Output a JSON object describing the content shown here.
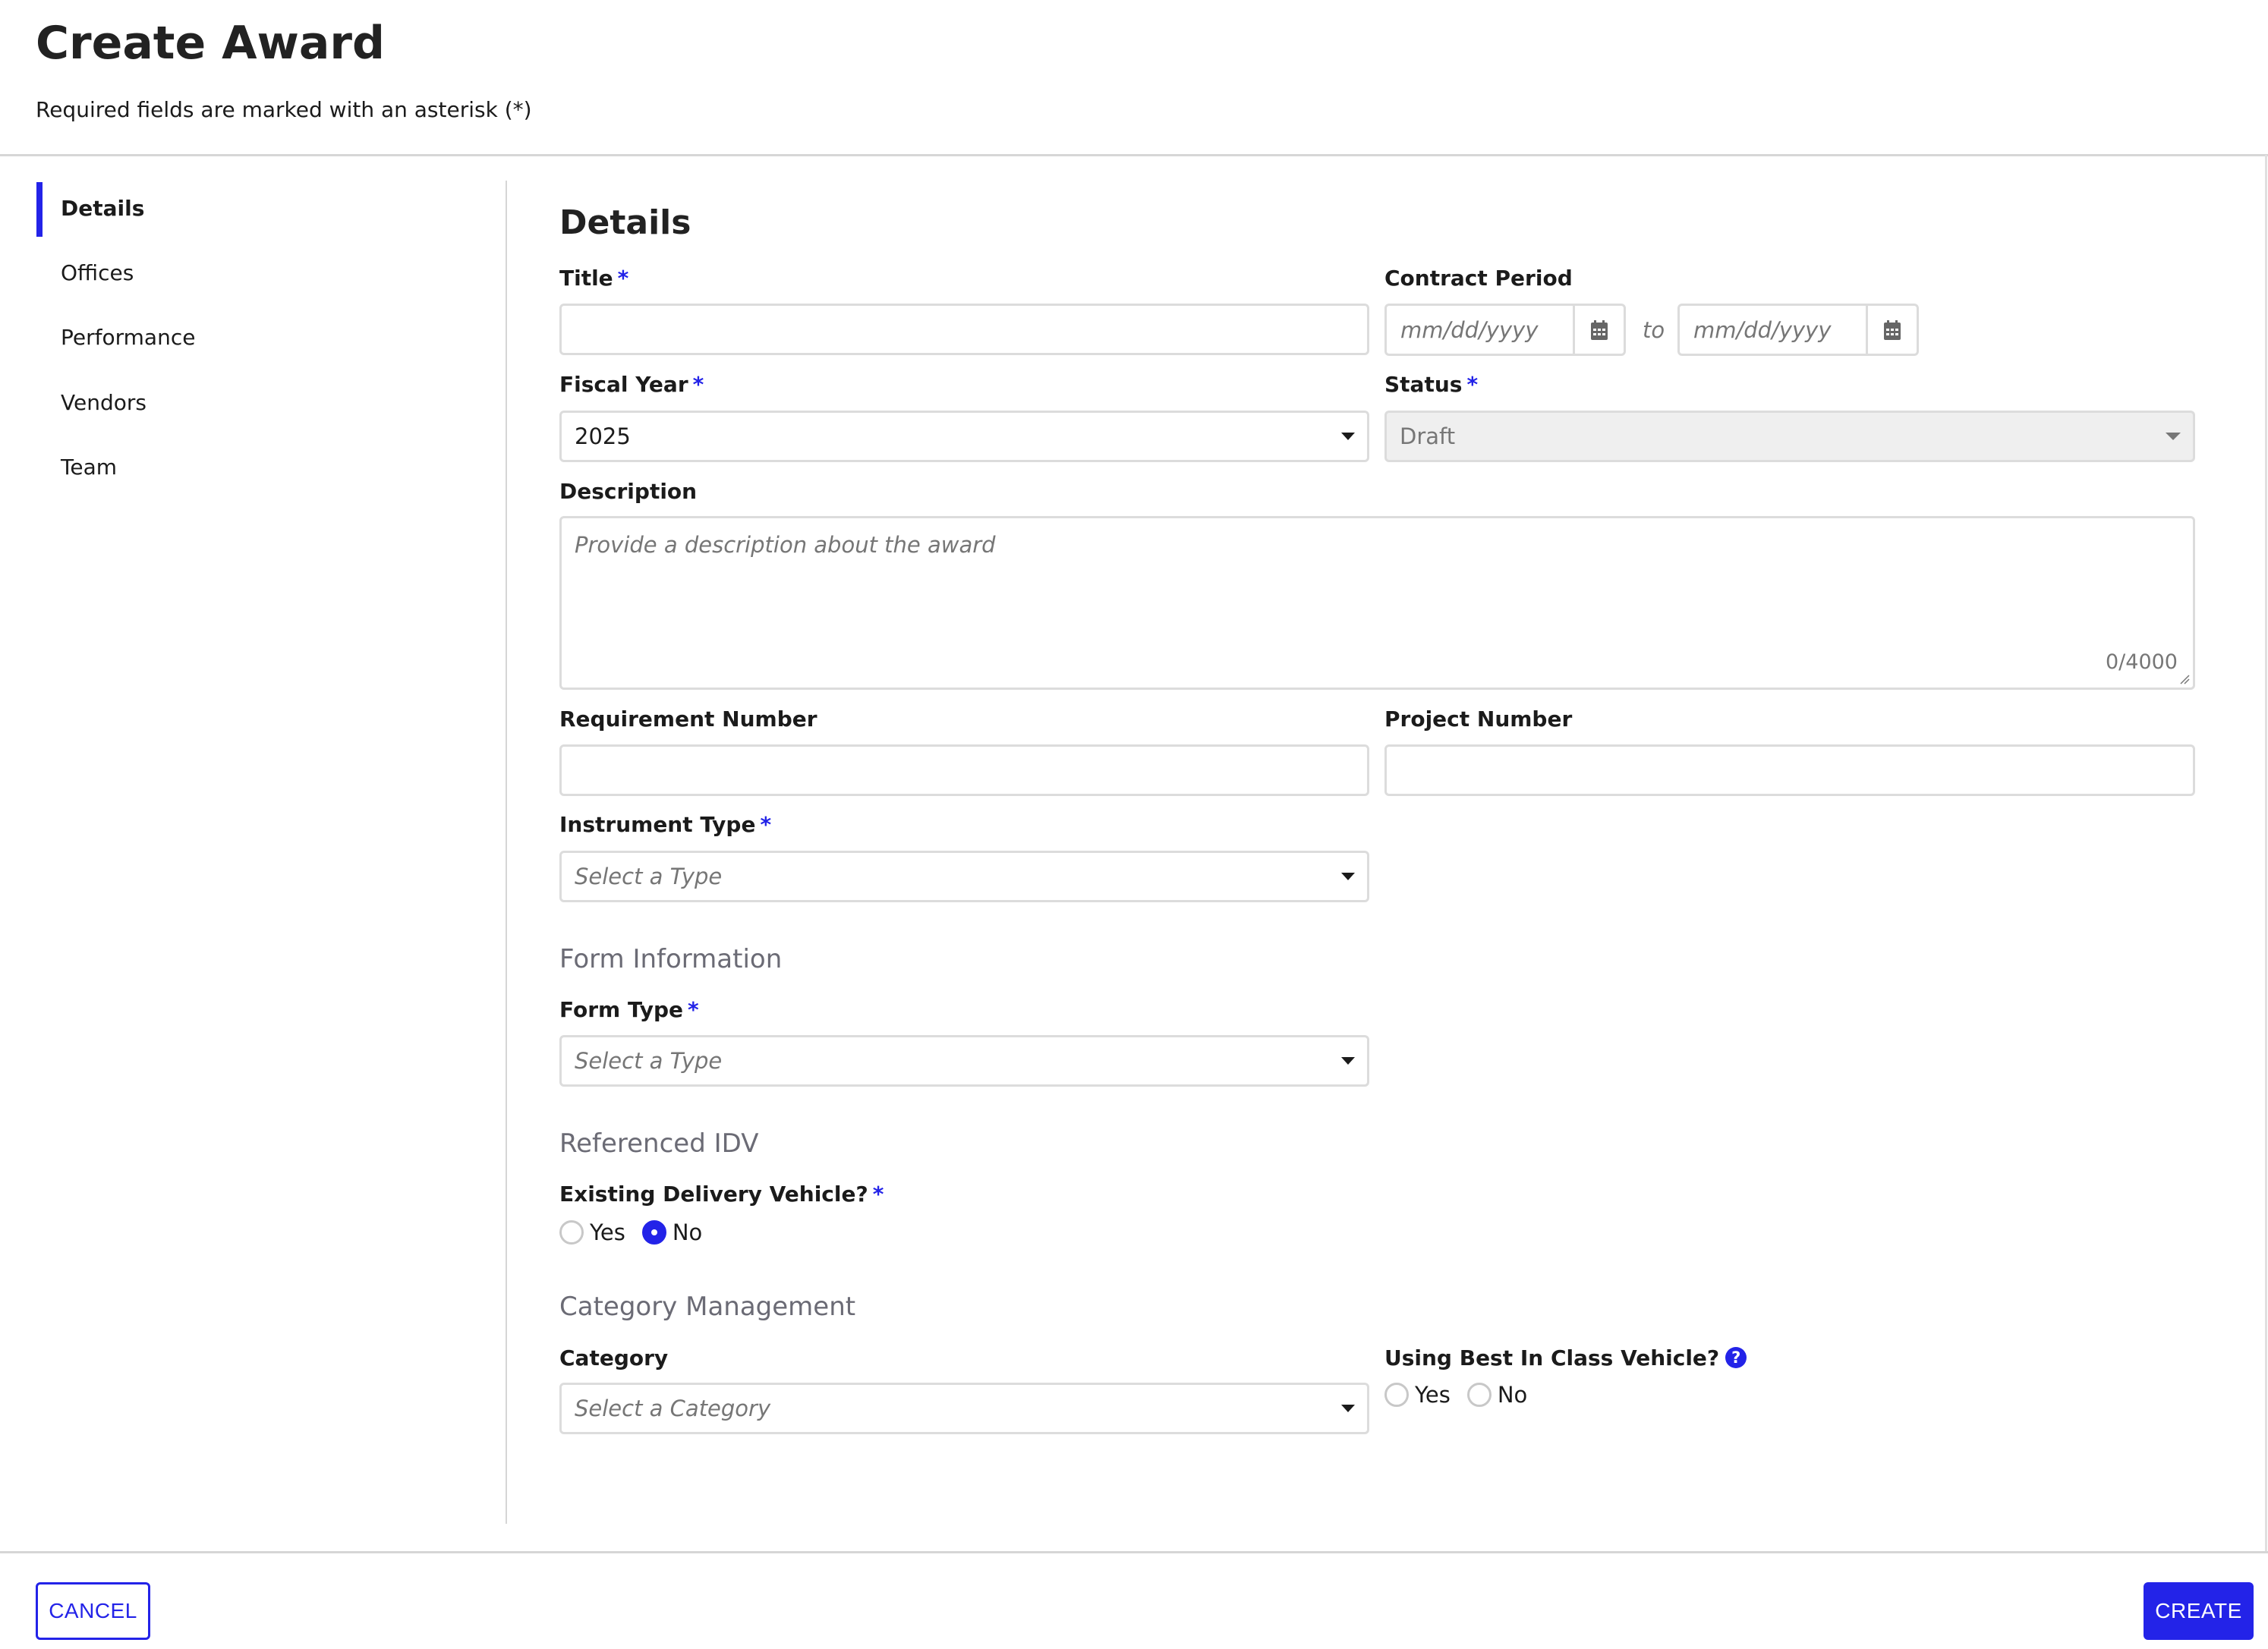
{
  "header": {
    "title": "Create Award",
    "subtitle": "Required fields are marked with an asterisk (*)"
  },
  "sidebar": {
    "items": [
      {
        "label": "Details",
        "active": true
      },
      {
        "label": "Offices",
        "active": false
      },
      {
        "label": "Performance",
        "active": false
      },
      {
        "label": "Vendors",
        "active": false
      },
      {
        "label": "Team",
        "active": false
      }
    ]
  },
  "form": {
    "section_title": "Details",
    "required_marker": "*",
    "title": {
      "label": "Title",
      "value": "",
      "placeholder": ""
    },
    "contract_period": {
      "label": "Contract Period",
      "start_placeholder": "mm/dd/yyyy",
      "end_placeholder": "mm/dd/yyyy",
      "separator": "to",
      "icon": "calendar-icon"
    },
    "fiscal_year": {
      "label": "Fiscal Year",
      "value": "2025"
    },
    "status": {
      "label": "Status",
      "value": "Draft",
      "disabled": true
    },
    "description": {
      "label": "Description",
      "placeholder": "Provide a description about the award",
      "value": "",
      "counter": "0/4000"
    },
    "requirement_number": {
      "label": "Requirement Number",
      "value": ""
    },
    "project_number": {
      "label": "Project Number",
      "value": ""
    },
    "instrument_type": {
      "label": "Instrument Type",
      "placeholder": "Select a Type"
    },
    "form_information": {
      "group_title": "Form Information",
      "form_type": {
        "label": "Form Type",
        "placeholder": "Select a Type"
      }
    },
    "referenced_idv": {
      "group_title": "Referenced IDV",
      "existing_delivery_vehicle": {
        "label": "Existing Delivery Vehicle?",
        "options": [
          "Yes",
          "No"
        ],
        "selected": "No"
      }
    },
    "category_management": {
      "group_title": "Category Management",
      "category": {
        "label": "Category",
        "placeholder": "Select a Category"
      },
      "best_in_class": {
        "label": "Using Best In Class Vehicle?",
        "help_icon": "question-circle-icon",
        "help_glyph": "?",
        "options": [
          "Yes",
          "No"
        ],
        "selected": null
      }
    }
  },
  "footer": {
    "cancel_label": "CANCEL",
    "create_label": "CREATE"
  },
  "colors": {
    "accent": "#2323e8",
    "border": "#dcdcdc",
    "disabled_bg": "#efefef",
    "group_title": "#6b6b75"
  }
}
